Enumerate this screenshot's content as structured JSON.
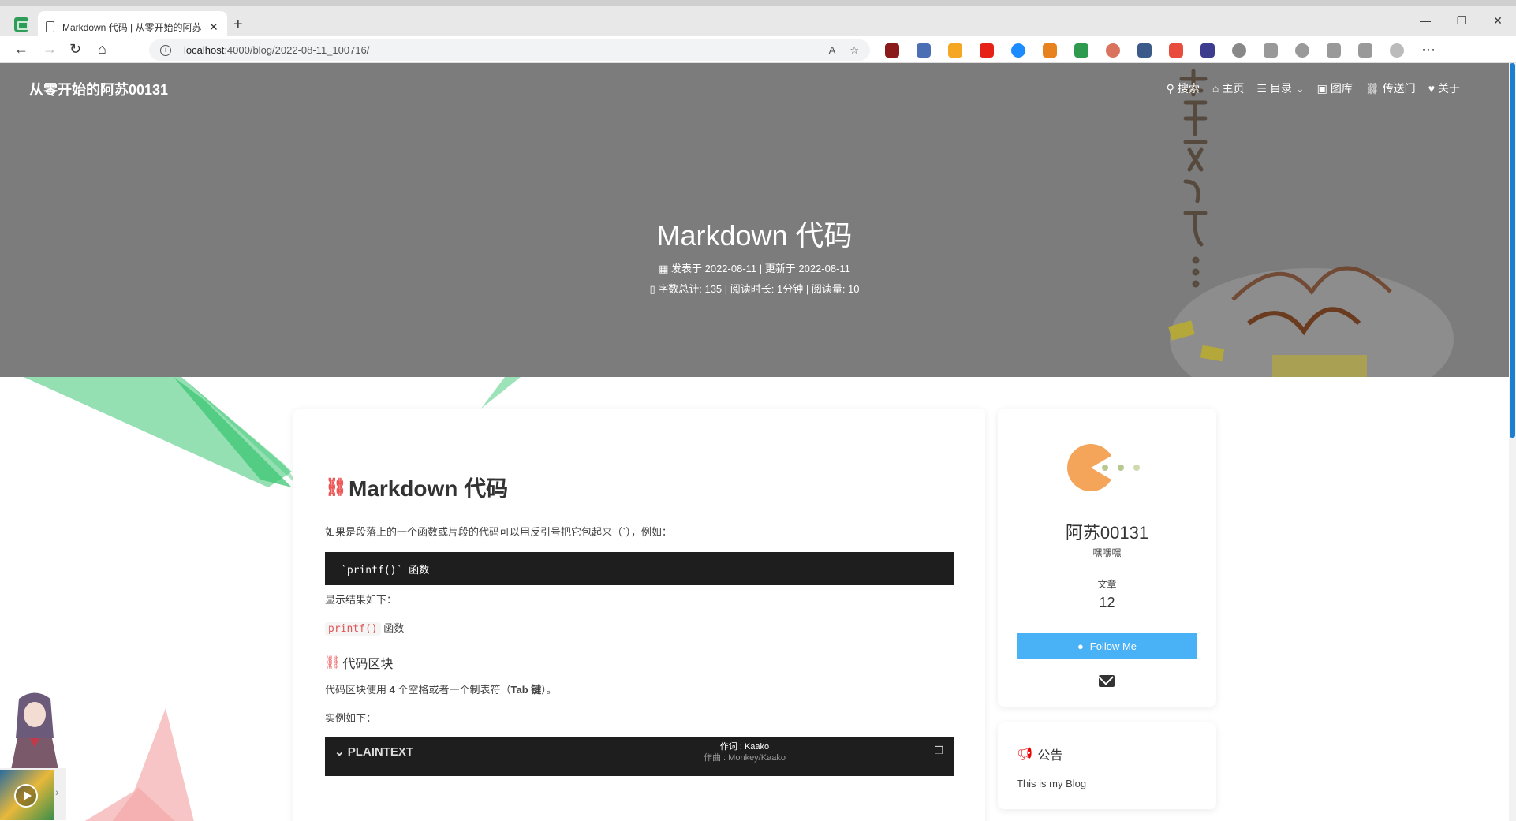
{
  "browser": {
    "tab_title": "Markdown 代码 | 从零开始的阿苏",
    "url_host": "localhost",
    "url_rest": ":4000/blog/2022-08-11_100716/"
  },
  "site": {
    "name": "从零开始的阿苏00131",
    "nav": [
      {
        "icon": "search-icon",
        "label": "搜索"
      },
      {
        "icon": "home-icon",
        "label": "主页"
      },
      {
        "icon": "list-icon",
        "label": "目录"
      },
      {
        "icon": "image-icon",
        "label": "图库"
      },
      {
        "icon": "link-icon",
        "label": "传送门"
      },
      {
        "icon": "heart-icon",
        "label": "关于"
      }
    ]
  },
  "post": {
    "title": "Markdown 代码",
    "meta_line1": "发表于 2022-08-11 | 更新于 2022-08-11",
    "meta_line2": "字数总计: 135 | 阅读时长: 1分钟 | 阅读量: 10",
    "h1": "Markdown 代码",
    "intro": "如果是段落上的一个函数或片段的代码可以用反引号把它包起来（`），例如：",
    "code_example": "`printf()` 函数",
    "result_label": "显示结果如下：",
    "inline_code": "printf()",
    "inline_suffix": " 函数",
    "h2": "代码区块",
    "block_desc_pre": "代码区块使用 ",
    "block_desc_b1": "4",
    "block_desc_mid": " 个空格或者一个制表符（",
    "block_desc_b2": "Tab 键",
    "block_desc_post": "）。",
    "example_label": "实例如下：",
    "code_lang": "PLAINTEXT",
    "lyric_line1": "作词 : Kaako",
    "lyric_line2": "作曲 : Monkey/Kaako"
  },
  "profile": {
    "author": "阿苏00131",
    "bio": "嘿嘿嘿",
    "stat_label": "文章",
    "stat_value": "12",
    "follow_label": "Follow Me"
  },
  "notice": {
    "title": "公告",
    "text": "This is my Blog"
  },
  "colors": {
    "accent": "#49b1f5",
    "hero_overlay": "#7c7c7c",
    "code_bg": "#1e1e1e"
  }
}
